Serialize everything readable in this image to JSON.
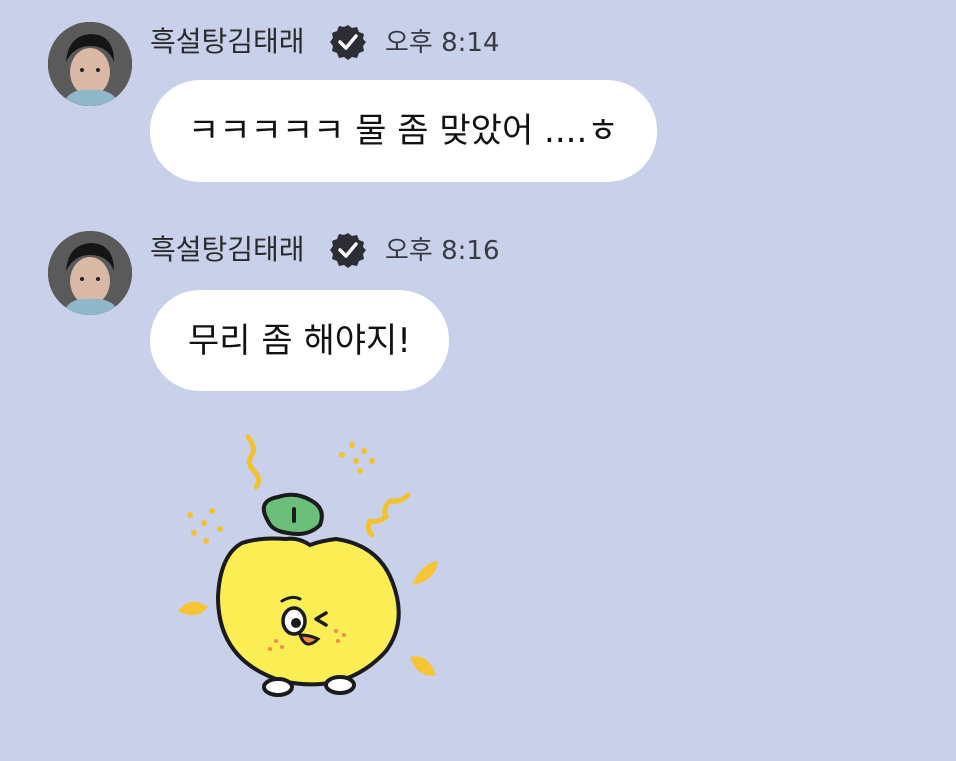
{
  "messages": [
    {
      "sender": "흑설탕김태래",
      "time": "오후 8:14",
      "text": "ㅋㅋㅋㅋㅋ 물 좀 맞았어 ....ㅎ"
    },
    {
      "sender": "흑설탕김태래",
      "time": "오후 8:16",
      "text": "무리 좀 해야지!"
    }
  ],
  "icons": {
    "verified": "verified-badge-icon",
    "sticker": "lemon-character-sticker"
  },
  "colors": {
    "background": "#c8d0ea",
    "bubble": "#ffffff",
    "lemon": "#fbee55",
    "leaf": "#6cbf7a"
  }
}
